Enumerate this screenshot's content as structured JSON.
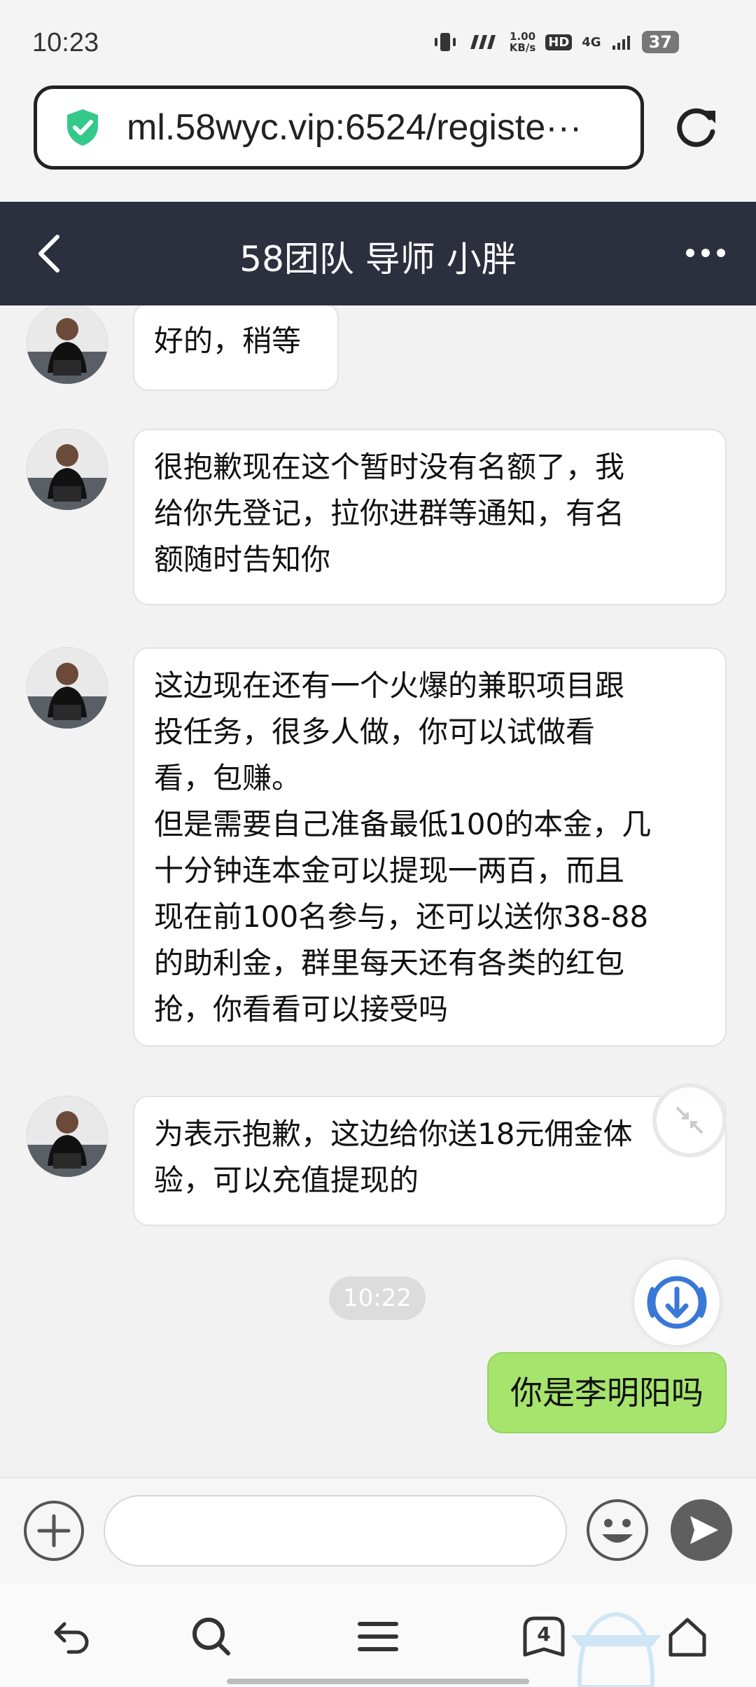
{
  "status_bar": {
    "time": "10:23",
    "net_speed": "1.00\nKB/s",
    "hd": "HD",
    "network": "4G",
    "battery": "37"
  },
  "browser": {
    "url": "ml.58wyc.vip:6524/registe···"
  },
  "chat_header": {
    "title": "58团队 导师 小胖"
  },
  "messages": [
    {
      "text": "好的，稍等"
    },
    {
      "text": "很抱歉现在这个暂时没有名额了，我\n给你先登记，拉你进群等通知，有名\n额随时告知你"
    },
    {
      "text": "这边现在还有一个火爆的兼职项目跟\n投任务，很多人做，你可以试做看\n看，包赚。\n但是需要自己准备最低100的本金，几\n十分钟连本金可以提现一两百，而且\n现在前100名参与，还可以送你38-88\n的助利金，群里每天还有各类的红包\n抢，你看看可以接受吗"
    },
    {
      "text": "为表示抱歉，这边给你送18元佣金体\n验，可以充值提现的"
    }
  ],
  "timestamp": "10:22",
  "sent_message": "你是李明阳吗",
  "input": {
    "value": "",
    "placeholder": ""
  },
  "bottom_nav": {
    "tab_count": "4"
  },
  "colors": {
    "header_bg": "#2b2f3e",
    "sent_bubble": "#a6e46e",
    "shield": "#34c98b",
    "accent_blue": "#3a78d8"
  },
  "icons": [
    "vibrate-icon",
    "signal-icon",
    "hd-icon",
    "network-4g-icon",
    "battery-icon",
    "shield-check-icon",
    "reload-icon",
    "back-arrow-icon",
    "more-dots-icon",
    "collapse-icon",
    "download-icon",
    "plus-icon",
    "emoji-icon",
    "send-icon",
    "nav-back-icon",
    "search-icon",
    "menu-icon",
    "tabs-icon",
    "home-icon"
  ]
}
